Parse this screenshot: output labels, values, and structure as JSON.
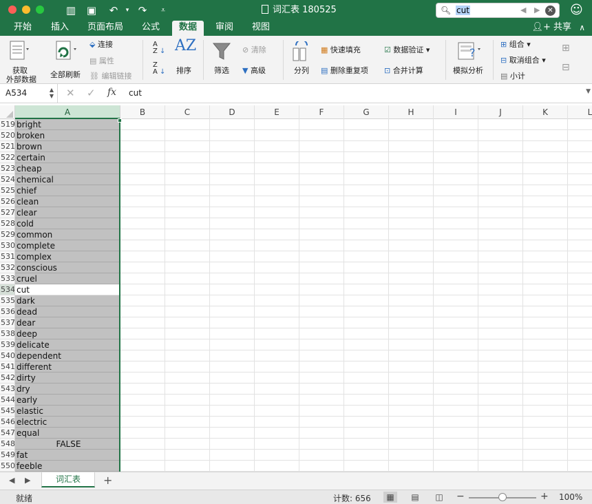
{
  "window": {
    "title": "词汇表 180525"
  },
  "search": {
    "value": "cut"
  },
  "tabs": [
    "开始",
    "插入",
    "页面布局",
    "公式",
    "数据",
    "审阅",
    "视图"
  ],
  "active_tab": "数据",
  "share_label": "共享",
  "ribbon": {
    "get_external_data_1": "获取",
    "get_external_data_2": "外部数据",
    "refresh_all": "全部刷新",
    "connections": "连接",
    "properties": "属性",
    "edit_links": "编辑链接",
    "sort": "排序",
    "filter": "筛选",
    "clear": "清除",
    "advanced": "高级",
    "text_to_columns": "分列",
    "flash_fill": "快速填充",
    "remove_duplicates": "删除重复项",
    "data_validation": "数据验证",
    "consolidate": "合并计算",
    "what_if": "模拟分析",
    "group": "组合",
    "ungroup": "取消组合",
    "subtotal": "小计"
  },
  "formula_bar": {
    "name_box": "A534",
    "fx": "fx",
    "value": "cut"
  },
  "columns": [
    "A",
    "B",
    "C",
    "D",
    "E",
    "F",
    "G",
    "H",
    "I",
    "J",
    "K",
    "L"
  ],
  "rows": [
    {
      "n": "519",
      "a": "bright"
    },
    {
      "n": "520",
      "a": "broken"
    },
    {
      "n": "521",
      "a": "brown"
    },
    {
      "n": "522",
      "a": "certain"
    },
    {
      "n": "523",
      "a": "cheap"
    },
    {
      "n": "524",
      "a": "chemical"
    },
    {
      "n": "525",
      "a": "chief"
    },
    {
      "n": "526",
      "a": "clean"
    },
    {
      "n": "527",
      "a": "clear"
    },
    {
      "n": "528",
      "a": "cold"
    },
    {
      "n": "529",
      "a": "common"
    },
    {
      "n": "530",
      "a": "complete"
    },
    {
      "n": "531",
      "a": "complex"
    },
    {
      "n": "532",
      "a": "conscious"
    },
    {
      "n": "533",
      "a": "cruel"
    },
    {
      "n": "534",
      "a": "cut"
    },
    {
      "n": "535",
      "a": "dark"
    },
    {
      "n": "536",
      "a": "dead"
    },
    {
      "n": "537",
      "a": "dear"
    },
    {
      "n": "538",
      "a": "deep"
    },
    {
      "n": "539",
      "a": "delicate"
    },
    {
      "n": "540",
      "a": "dependent"
    },
    {
      "n": "541",
      "a": "different"
    },
    {
      "n": "542",
      "a": "dirty"
    },
    {
      "n": "543",
      "a": "dry"
    },
    {
      "n": "544",
      "a": "early"
    },
    {
      "n": "545",
      "a": "elastic"
    },
    {
      "n": "546",
      "a": "electric"
    },
    {
      "n": "547",
      "a": "equal"
    },
    {
      "n": "548",
      "a": "FALSE"
    },
    {
      "n": "549",
      "a": "fat"
    },
    {
      "n": "550",
      "a": "feeble"
    }
  ],
  "active_row": "534",
  "sheet_tab": "词汇表",
  "status": {
    "ready": "就绪",
    "count": "计数: 656",
    "zoom": "100%"
  },
  "colors": {
    "accent": "#217346",
    "selection": "#c1c1c1"
  }
}
